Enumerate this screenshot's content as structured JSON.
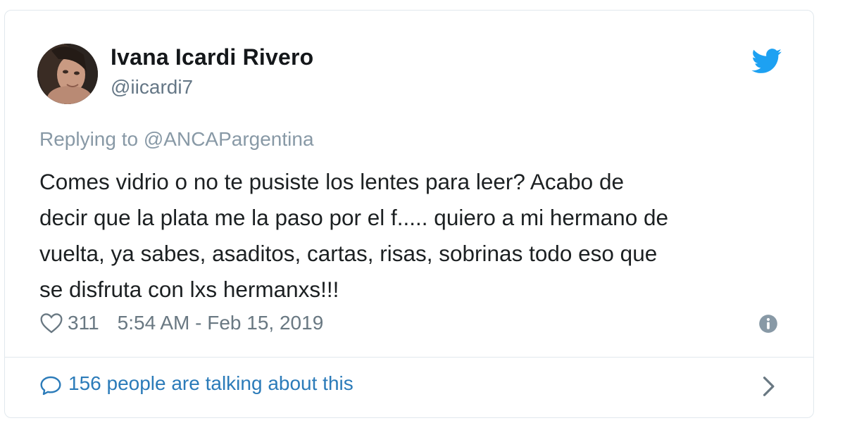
{
  "author": {
    "name": "Ivana Icardi Rivero",
    "handle": "@iicardi7"
  },
  "icons": {
    "brand": "twitter-bird-icon",
    "like": "heart-icon",
    "info": "info-icon",
    "reply": "comment-bubble-icon",
    "more": "chevron-right-icon"
  },
  "colors": {
    "twitter_blue": "#1da1f2",
    "link_blue": "#2b7bb9",
    "text": "#1c2022",
    "muted": "#697882"
  },
  "reply_context": {
    "prefix": "Replying to",
    "mention": "@ANCAPargentina"
  },
  "tweet": {
    "lines": [
      "Comes vidrio o no te pusiste los lentes para leer? Acabo de",
      "decir que la plata me la paso por el f..... quiero a mi hermano de",
      "vuelta, ya sabes, asaditos, cartas, risas, sobrinas todo eso que",
      "se disfruta con lxs hermanxs!!!"
    ]
  },
  "meta": {
    "likes": "311",
    "timestamp": "5:54 AM - Feb 15, 2019"
  },
  "footer": {
    "talking_text": "156 people are talking about this"
  }
}
